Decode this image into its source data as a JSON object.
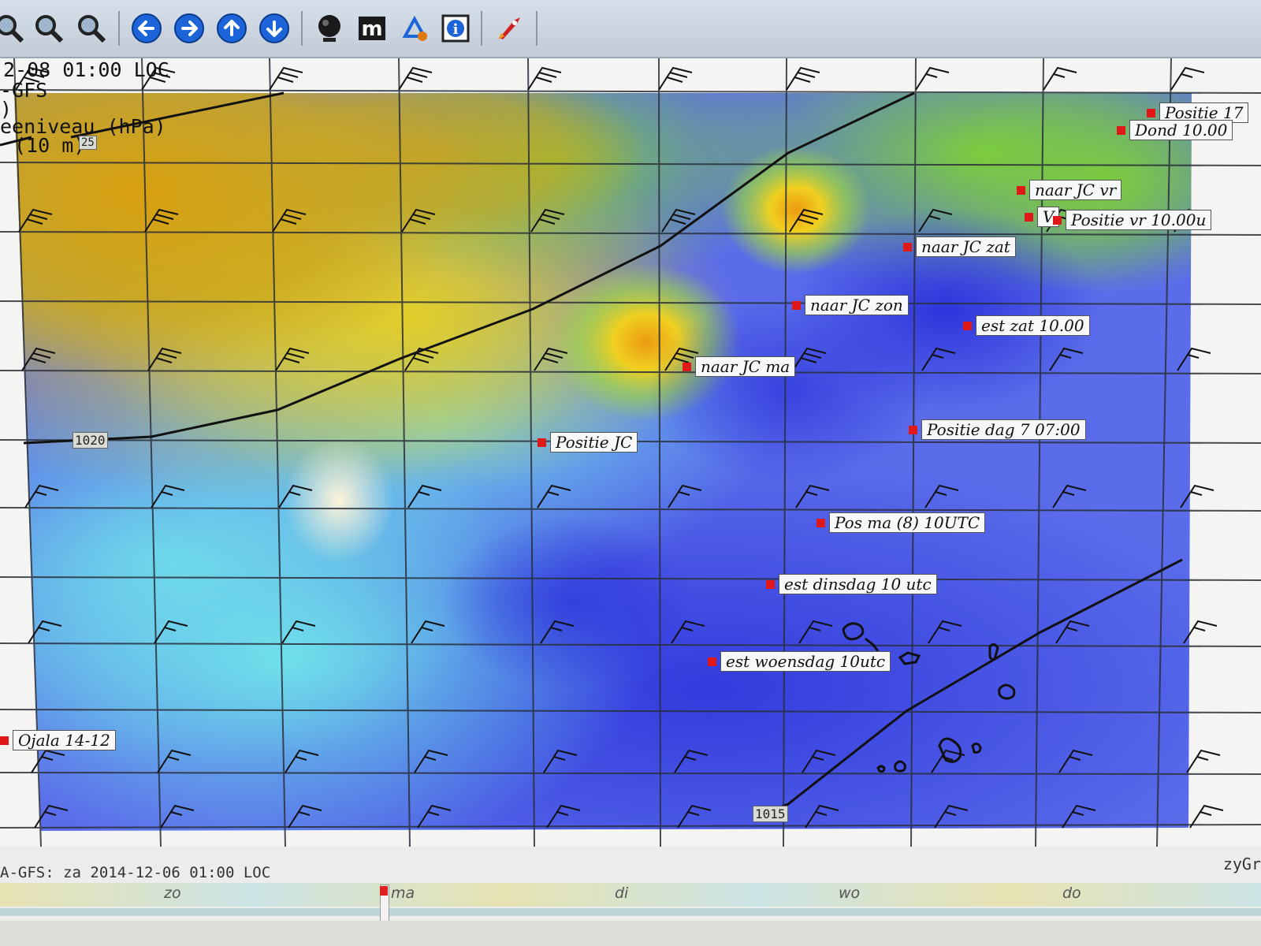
{
  "toolbar": {
    "buttons": [
      {
        "name": "zoom-in",
        "icon": "magnifier-icon"
      },
      {
        "name": "zoom-out",
        "icon": "magnifier-icon"
      },
      {
        "name": "zoom-1-1",
        "icon": "magnifier-icon"
      },
      {
        "name": "pan-left",
        "icon": "arrow-left-icon"
      },
      {
        "name": "pan-right",
        "icon": "arrow-right-icon"
      },
      {
        "name": "pan-up",
        "icon": "arrow-up-icon"
      },
      {
        "name": "pan-down",
        "icon": "arrow-down-icon"
      },
      {
        "name": "globe",
        "icon": "globe-icon"
      },
      {
        "name": "measure",
        "icon": "m-icon",
        "glyph": "m"
      },
      {
        "name": "route",
        "icon": "route-icon"
      },
      {
        "name": "info",
        "icon": "info-icon",
        "glyph": "i"
      },
      {
        "name": "rocket",
        "icon": "rocket-icon"
      }
    ]
  },
  "overlay": {
    "datetime": "2-08 01:00 LOC",
    "model": "-GFS",
    "line3": ")",
    "pressure_label": "eeniveau (hPa)",
    "wind_label": "(10 m)"
  },
  "isobars": {
    "upper": "1020",
    "lower": "1015",
    "small": "25"
  },
  "waypoints": [
    {
      "label": "Positie 17"
    },
    {
      "label": "Dond 10.00"
    },
    {
      "label": "naar JC vr"
    },
    {
      "label": "V"
    },
    {
      "label": "Positie vr 10.00u"
    },
    {
      "label": "naar JC zat"
    },
    {
      "label": "naar JC zon"
    },
    {
      "label": "est zat 10.00"
    },
    {
      "label": "naar JC ma"
    },
    {
      "label": "Positie JC"
    },
    {
      "label": "Positie dag 7 07:00"
    },
    {
      "label": "Pos ma (8) 10UTC"
    },
    {
      "label": "est dinsdag 10 utc"
    },
    {
      "label": "est woensdag 10utc"
    },
    {
      "label": "Ojala 14-12"
    }
  ],
  "status_line": "A-GFS: za 2014-12-06 01:00 LOC",
  "brand": "zyGr",
  "timeline": {
    "days": [
      "zo",
      "ma",
      "di",
      "wo",
      "do"
    ]
  },
  "colors": {
    "dot": "#e01818",
    "toolbar_blue": "#1d64d8"
  }
}
